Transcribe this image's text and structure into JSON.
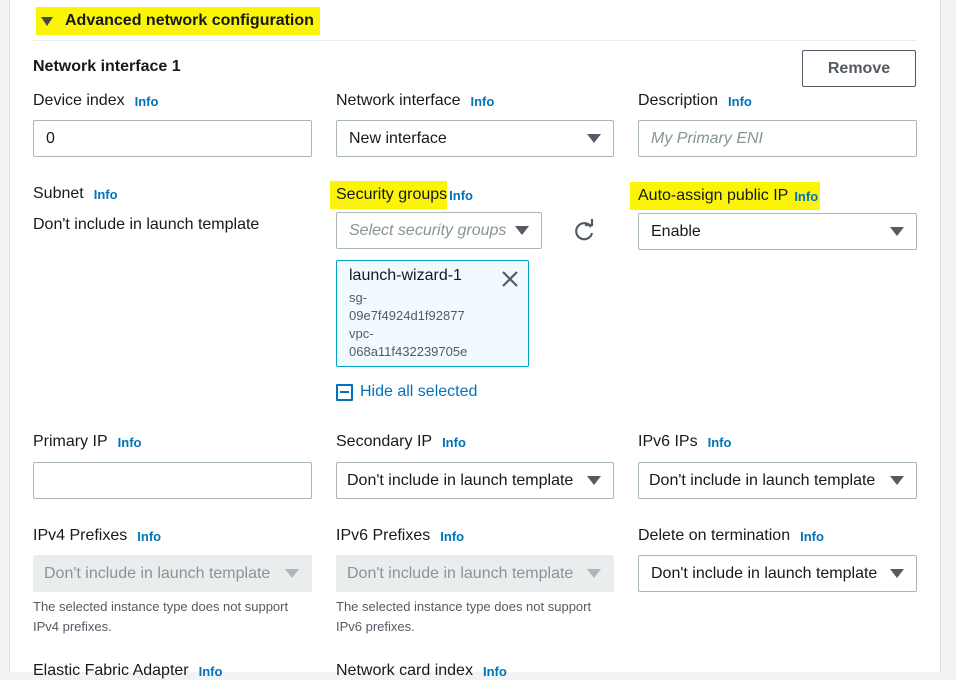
{
  "section": {
    "title": "Advanced network configuration"
  },
  "interface": {
    "title": "Network interface 1",
    "remove_label": "Remove"
  },
  "info_label": "Info",
  "fields": {
    "device_index": {
      "label": "Device index",
      "value": "0"
    },
    "network_interface": {
      "label": "Network interface",
      "value": "New interface"
    },
    "description": {
      "label": "Description",
      "placeholder": "My Primary ENI"
    },
    "subnet": {
      "label": "Subnet",
      "value": "Don't include in launch template"
    },
    "security_groups": {
      "label": "Security groups",
      "placeholder": "Select security groups",
      "selected": [
        {
          "name": "launch-wizard-1",
          "line1": "sg-",
          "line2": "09e7f4924d1f92877",
          "line3": "vpc-",
          "line4": "068a11f432239705e"
        }
      ],
      "hide_all_label": "Hide all selected"
    },
    "auto_assign_ip": {
      "label": "Auto-assign public IP",
      "value": "Enable"
    },
    "primary_ip": {
      "label": "Primary IP",
      "value": ""
    },
    "secondary_ip": {
      "label": "Secondary IP",
      "value": "Don't include in launch template"
    },
    "ipv6_ips": {
      "label": "IPv6 IPs",
      "value": "Don't include in launch template"
    },
    "ipv4_prefixes": {
      "label": "IPv4 Prefixes",
      "value": "Don't include in launch template",
      "help": "The selected instance type does not support IPv4 prefixes."
    },
    "ipv6_prefixes": {
      "label": "IPv6 Prefixes",
      "value": "Don't include in launch template",
      "help": "The selected instance type does not support IPv6 prefixes."
    },
    "delete_on_termination": {
      "label": "Delete on termination",
      "value": "Don't include in launch template"
    },
    "elastic_fabric_adapter": {
      "label": "Elastic Fabric Adapter"
    },
    "network_card_index": {
      "label": "Network card index"
    }
  },
  "highlight_color": "#fbf407",
  "link_color": "#0073bb"
}
